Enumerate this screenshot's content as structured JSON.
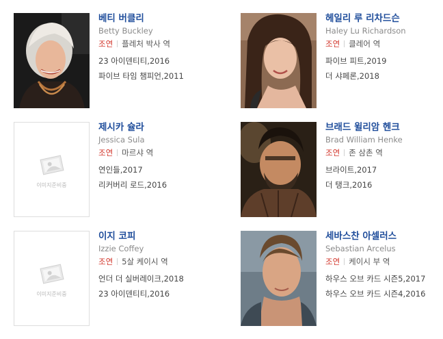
{
  "cast": [
    {
      "name_ko": "베티 버클리",
      "name_en": "Betty Buckley",
      "role_type": "조연",
      "role_name": "플레처 박사 역",
      "works": [
        "23 아이덴티티,2016",
        "파이브 타임 챔피언,2011"
      ],
      "photo": "portrait-photo"
    },
    {
      "name_ko": "헤일리 루 리차드슨",
      "name_en": "Haley Lu Richardson",
      "role_type": "조연",
      "role_name": "클레어 역",
      "works": [
        "파이브 피트,2019",
        "더 샤페론,2018"
      ],
      "photo": "portrait-photo"
    },
    {
      "name_ko": "제시카 슐라",
      "name_en": "Jessica Sula",
      "role_type": "조연",
      "role_name": "마르샤 역",
      "works": [
        "연인들,2017",
        "리커버리 로드,2016"
      ],
      "photo": "placeholder",
      "placeholder_text": "이미지준비중"
    },
    {
      "name_ko": "브래드 윌리암 헨크",
      "name_en": "Brad William Henke",
      "role_type": "조연",
      "role_name": "존 삼촌 역",
      "works": [
        "브라이트,2017",
        "더 탱크,2016"
      ],
      "photo": "portrait-photo"
    },
    {
      "name_ko": "이지 코피",
      "name_en": "Izzie Coffey",
      "role_type": "조연",
      "role_name": "5살 케이시 역",
      "works": [
        "언더 더 실버레이크,2018",
        "23 아이덴티티,2016"
      ],
      "photo": "placeholder",
      "placeholder_text": "이미지준비중"
    },
    {
      "name_ko": "세바스찬 아셀러스",
      "name_en": "Sebastian Arcelus",
      "role_type": "조연",
      "role_name": "케이시 부 역",
      "works": [
        "하우스 오브 카드 시즌5,2017",
        "하우스 오브 카드 시즌4,2016"
      ],
      "photo": "portrait-photo"
    }
  ],
  "colors": {
    "name_link": "#1f4d9b",
    "role_type": "#d2362b",
    "english_name": "#8a8a8a"
  }
}
